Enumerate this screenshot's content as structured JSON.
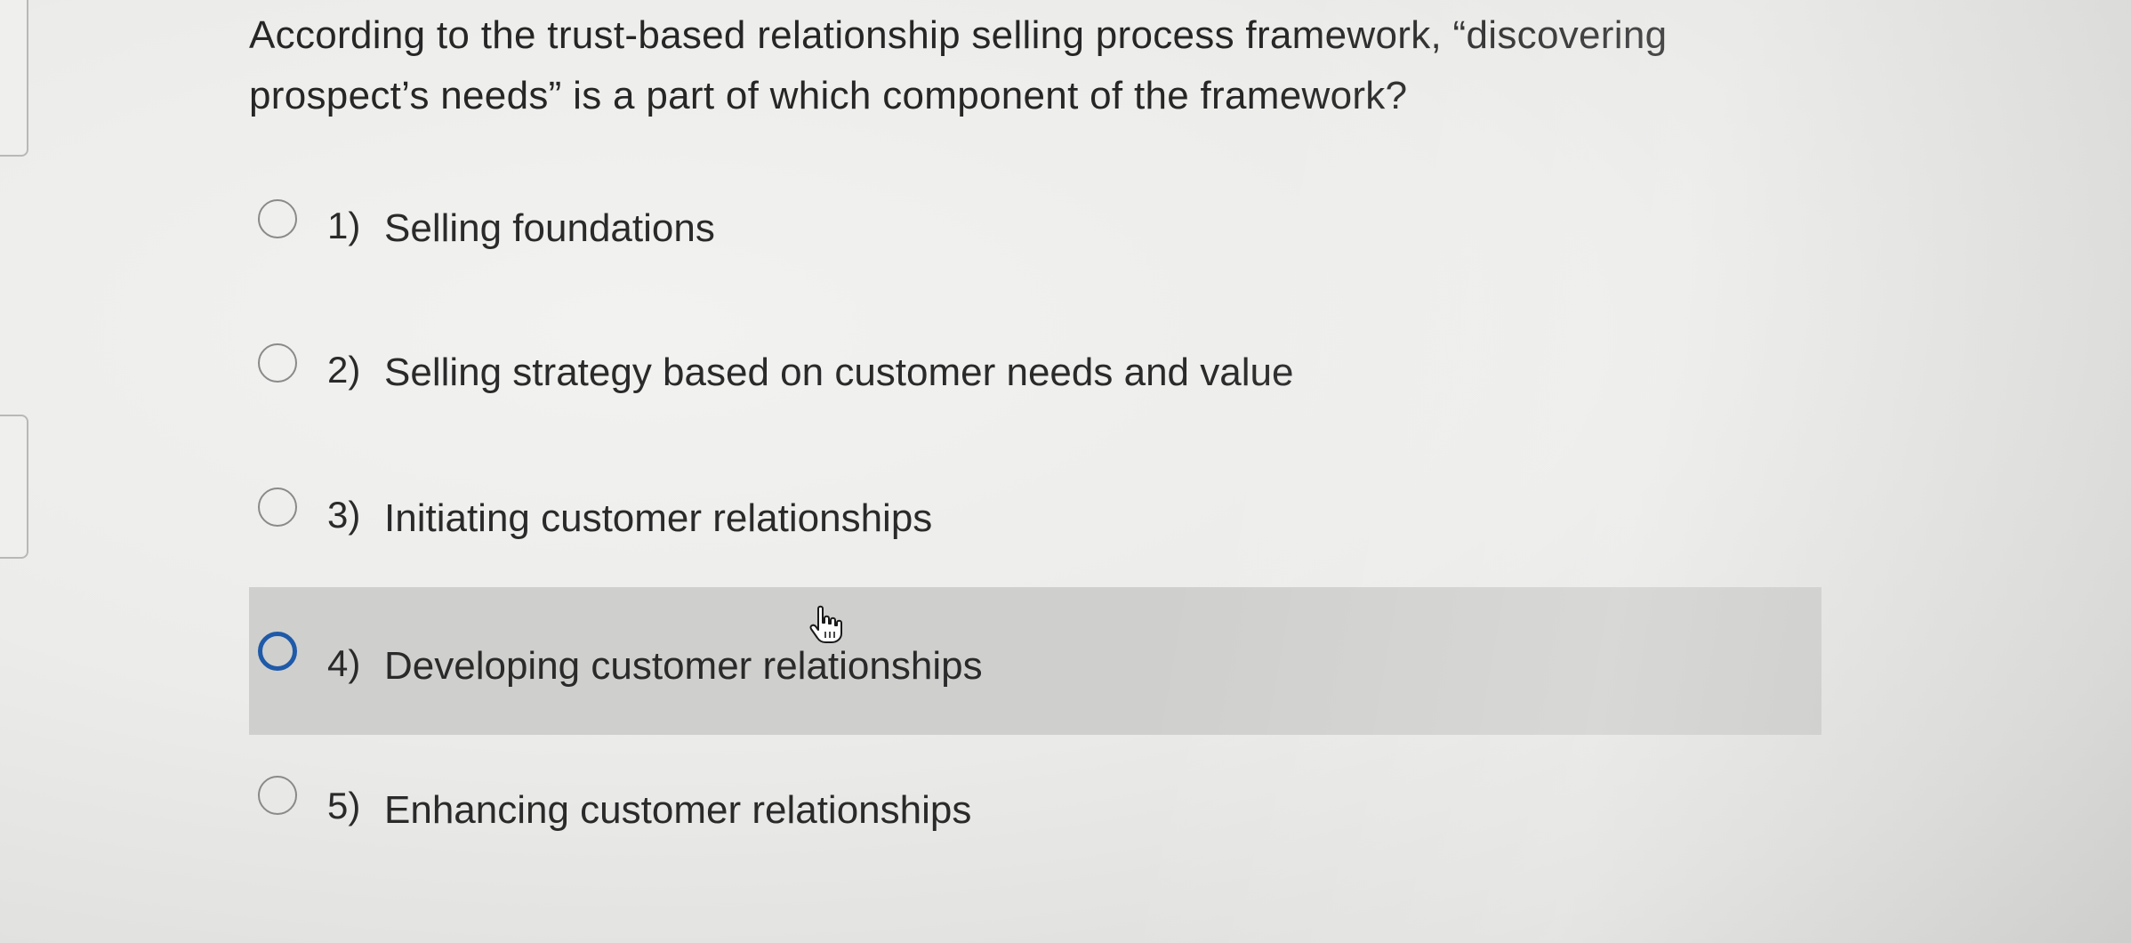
{
  "question": {
    "text": "According to the trust-based relationship selling process framework, “discovering prospect’s needs” is a part of which component of the framework?"
  },
  "options": [
    {
      "number": "1)",
      "label": "Selling foundations"
    },
    {
      "number": "2)",
      "label": "Selling strategy based on customer needs and value"
    },
    {
      "number": "3)",
      "label": "Initiating customer relationships"
    },
    {
      "number": "4)",
      "label": "Developing customer relationships"
    },
    {
      "number": "5)",
      "label": "Enhancing customer relationships"
    }
  ],
  "hovered_option_index": 3,
  "icons": {
    "radio": "radio-button-icon",
    "cursor": "hand-pointer-icon"
  },
  "colors": {
    "hover_background": "#cfcfcd",
    "hover_radio_border": "#1f5aa8",
    "radio_border": "#8a8a8a"
  }
}
